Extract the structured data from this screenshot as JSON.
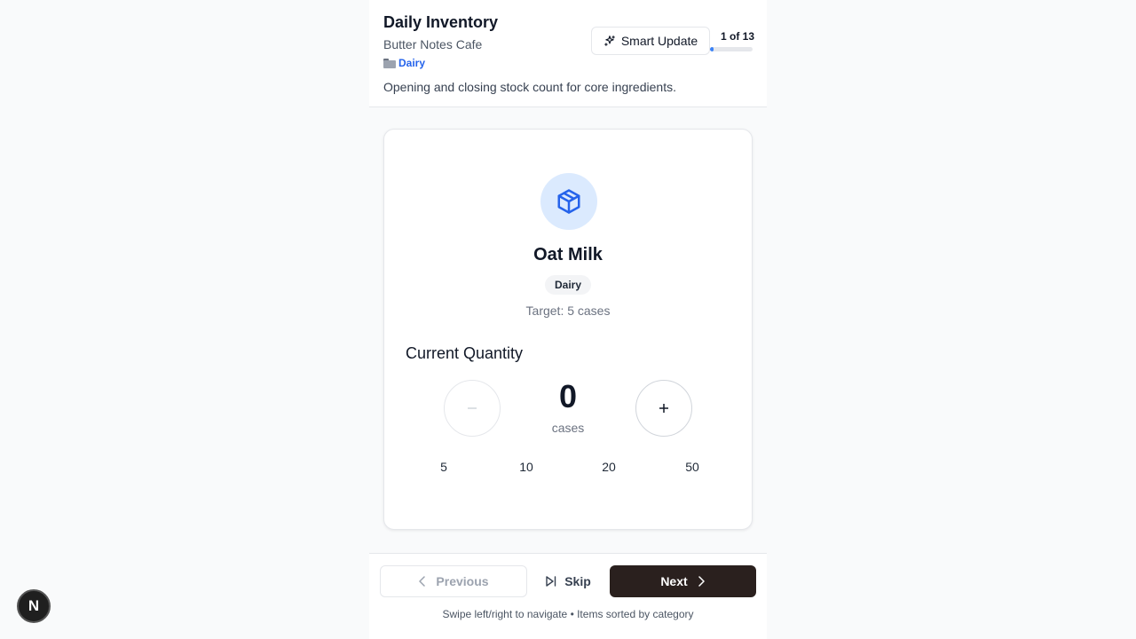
{
  "header": {
    "title": "Daily Inventory",
    "subtitle": "Butter Notes Cafe",
    "category": "Dairy",
    "description": "Opening and closing stock count for core ingredients.",
    "smart_update_label": "Smart Update",
    "progress_label": "1 of 13",
    "progress_fraction": 0.077
  },
  "item": {
    "icon": "package-icon",
    "name": "Oat Milk",
    "category_badge": "Dairy",
    "target": "Target: 5 cases",
    "quantity_label": "Current Quantity",
    "quantity_value": "0",
    "quantity_unit": "cases",
    "quick_values": [
      "5",
      "10",
      "20",
      "50"
    ]
  },
  "footer": {
    "previous_label": "Previous",
    "skip_label": "Skip",
    "next_label": "Next",
    "hint": "Swipe left/right to navigate • Items sorted by category"
  },
  "dev_badge": "N",
  "colors": {
    "accent": "#2563eb",
    "next_button": "#2a201e",
    "icon_bg": "#dbeafe"
  }
}
